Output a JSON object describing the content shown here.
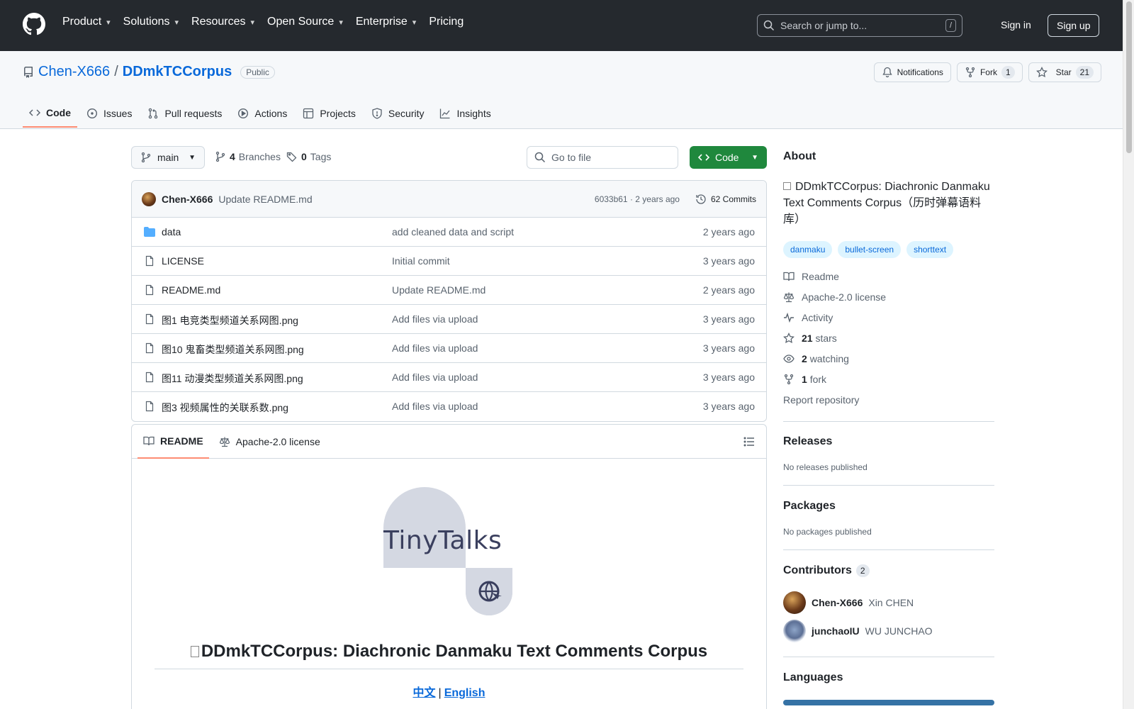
{
  "header": {
    "nav": [
      {
        "label": "Product",
        "has_menu": true
      },
      {
        "label": "Solutions",
        "has_menu": true
      },
      {
        "label": "Resources",
        "has_menu": true
      },
      {
        "label": "Open Source",
        "has_menu": true
      },
      {
        "label": "Enterprise",
        "has_menu": true
      },
      {
        "label": "Pricing",
        "has_menu": false
      }
    ],
    "search_placeholder": "Search or jump to...",
    "search_shortcut": "/",
    "sign_in": "Sign in",
    "sign_up": "Sign up"
  },
  "repo": {
    "owner": "Chen-X666",
    "separator": "/",
    "name": "DDmkTCCorpus",
    "visibility": "Public",
    "notifications_label": "Notifications",
    "fork_label": "Fork",
    "fork_count": "1",
    "star_label": "Star",
    "star_count": "21",
    "tabs": [
      {
        "label": "Code",
        "icon": "code-icon",
        "active": true
      },
      {
        "label": "Issues",
        "icon": "issue-icon",
        "active": false
      },
      {
        "label": "Pull requests",
        "icon": "pull-request-icon",
        "active": false
      },
      {
        "label": "Actions",
        "icon": "play-icon",
        "active": false
      },
      {
        "label": "Projects",
        "icon": "table-icon",
        "active": false
      },
      {
        "label": "Security",
        "icon": "shield-icon",
        "active": false
      },
      {
        "label": "Insights",
        "icon": "graph-icon",
        "active": false
      }
    ]
  },
  "toolbar": {
    "branch": "main",
    "branches_count": "4",
    "branches_label": "Branches",
    "tags_count": "0",
    "tags_label": "Tags",
    "goto_placeholder": "Go to file",
    "code_button": "Code"
  },
  "latest_commit": {
    "author": "Chen-X666",
    "message": "Update README.md",
    "sha_time": "6033b61 · 2 years ago",
    "commits_label": "62 Commits"
  },
  "files": [
    {
      "type": "folder",
      "name": "data",
      "message": "add cleaned data and script",
      "date": "2 years ago"
    },
    {
      "type": "file",
      "name": "LICENSE",
      "message": "Initial commit",
      "date": "3 years ago"
    },
    {
      "type": "file",
      "name": "README.md",
      "message": "Update README.md",
      "date": "2 years ago"
    },
    {
      "type": "file",
      "name": "图1 电竞类型频道关系网图.png",
      "message": "Add files via upload",
      "date": "3 years ago"
    },
    {
      "type": "file",
      "name": "图10 鬼畜类型频道关系网图.png",
      "message": "Add files via upload",
      "date": "3 years ago"
    },
    {
      "type": "file",
      "name": "图11 动漫类型频道关系网图.png",
      "message": "Add files via upload",
      "date": "3 years ago"
    },
    {
      "type": "file",
      "name": "图3 视频属性的关联系数.png",
      "message": "Add files via upload",
      "date": "3 years ago"
    }
  ],
  "readme": {
    "tab_readme": "README",
    "tab_license": "Apache-2.0 license",
    "logo_text": "TinyTalks",
    "heading": "DDmkTCCorpus: Diachronic Danmaku Text Comments Corpus",
    "lang_zh": "中文",
    "lang_sep": "|",
    "lang_en": "English"
  },
  "sidebar": {
    "about_title": "About",
    "description": "DDmkTCCorpus: Diachronic Danmaku Text Comments Corpus（历时弹幕语料库）",
    "topics": [
      "danmaku",
      "bullet-screen",
      "shorttext"
    ],
    "readme": "Readme",
    "license": "Apache-2.0 license",
    "activity": "Activity",
    "stars_count": "21",
    "stars_label": "stars",
    "watching_count": "2",
    "watching_label": "watching",
    "forks_count": "1",
    "forks_label": "fork",
    "report": "Report repository",
    "releases_title": "Releases",
    "releases_empty": "No releases published",
    "packages_title": "Packages",
    "packages_empty": "No packages published",
    "contributors_title": "Contributors",
    "contributors_count": "2",
    "contributors": [
      {
        "login": "Chen-X666",
        "name": "Xin CHEN"
      },
      {
        "login": "junchaoIU",
        "name": "WU JUNCHAO"
      }
    ],
    "languages_title": "Languages"
  },
  "colors": {
    "header_bg": "#25292e",
    "link": "#0969da",
    "primary_button": "#1f883d",
    "active_tab_underline": "#fd8c73",
    "topic_bg": "#ddf4ff",
    "language_python": "#3572a5"
  }
}
